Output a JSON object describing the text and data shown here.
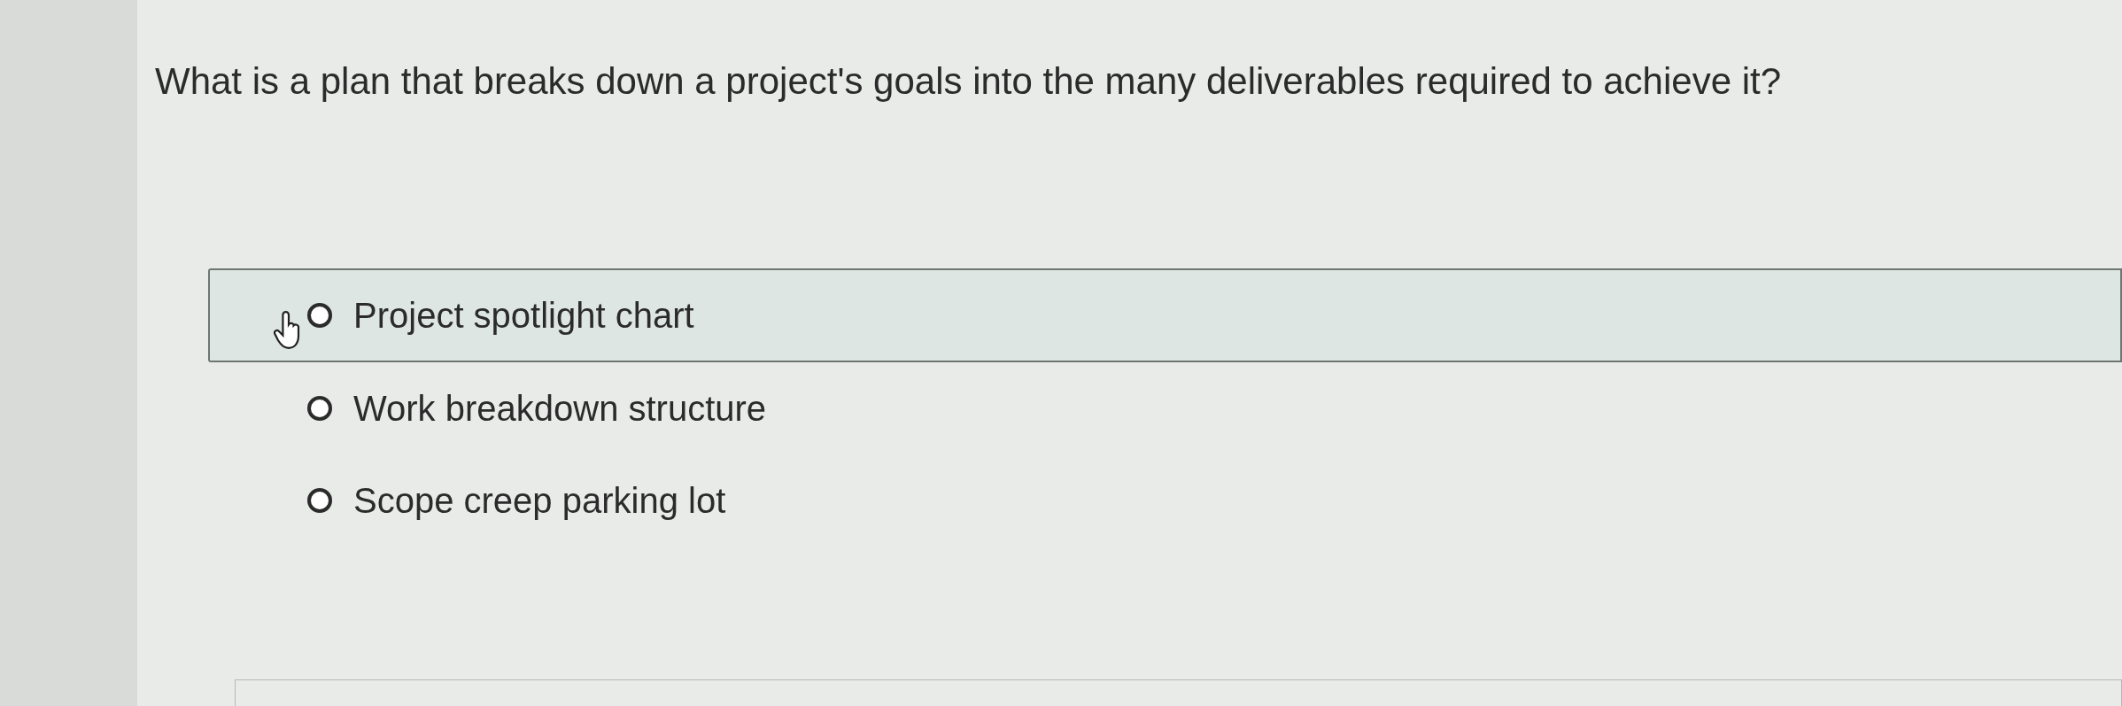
{
  "question": "What is a plan that breaks down a project's goals into the many deliverables required to achieve it?",
  "options": [
    {
      "label": "Project spotlight chart",
      "selected": false,
      "hovered": true
    },
    {
      "label": "Work breakdown structure",
      "selected": false,
      "hovered": false
    },
    {
      "label": "Scope creep parking lot",
      "selected": false,
      "hovered": false
    }
  ]
}
